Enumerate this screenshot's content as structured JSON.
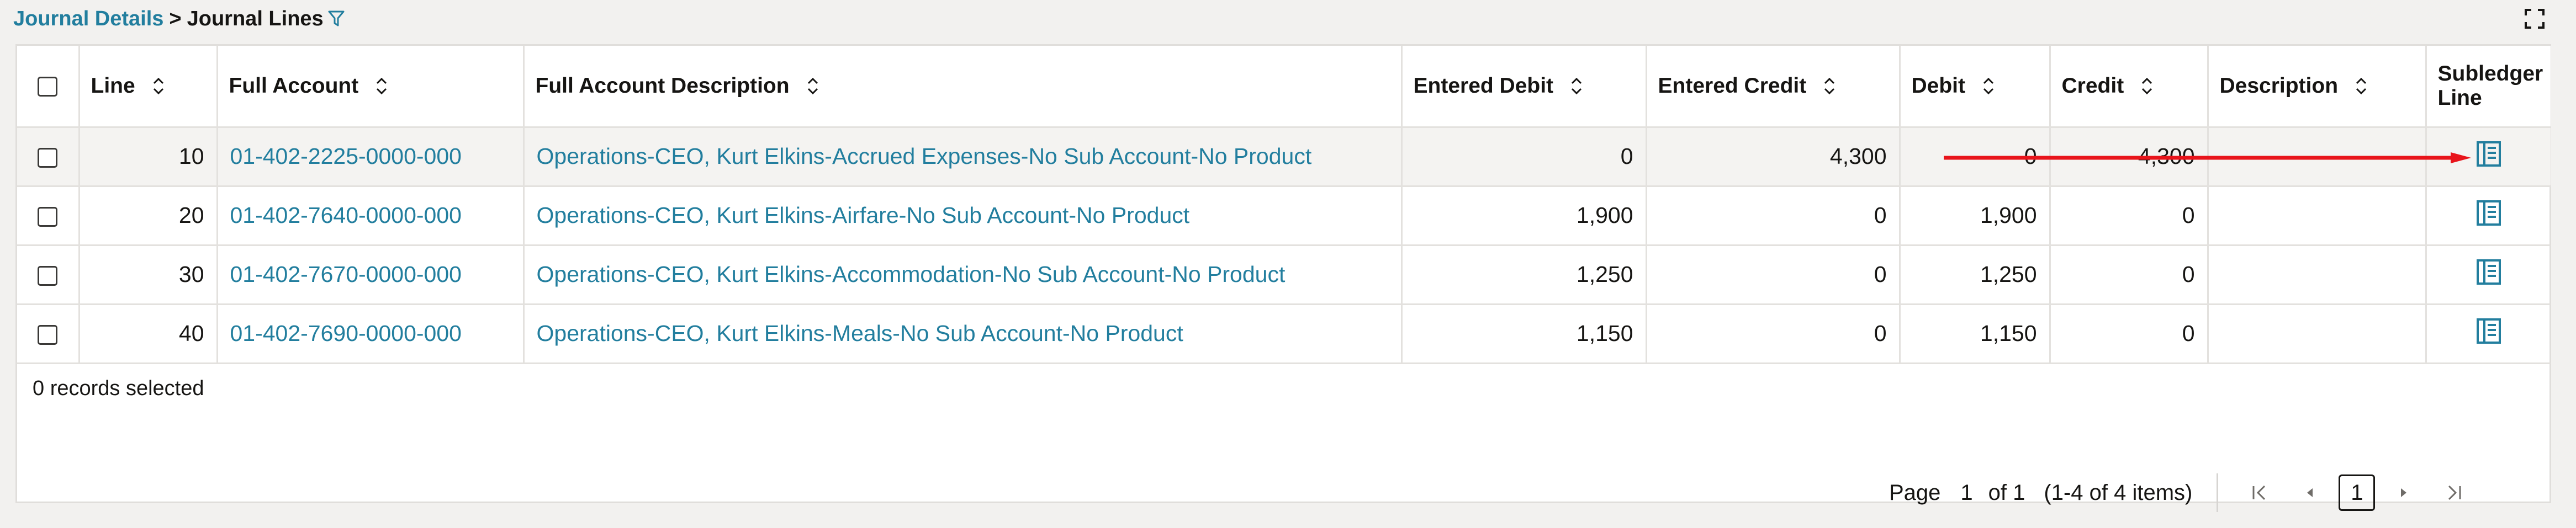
{
  "breadcrumb": {
    "parent": "Journal Details",
    "separator": ">",
    "current": "Journal Lines"
  },
  "icons": {
    "filter": "filter-icon",
    "expand": "expand-icon",
    "sort": "sort-icon",
    "subledger": "document-list-icon"
  },
  "colors": {
    "link": "#227e9e",
    "annotation_arrow": "#e8141b"
  },
  "table": {
    "columns": [
      "Line",
      "Full Account",
      "Full Account Description",
      "Entered Debit",
      "Entered Credit",
      "Debit",
      "Credit",
      "Description",
      "Subledger Line"
    ],
    "rows": [
      {
        "line": "10",
        "account": "01-402-2225-0000-000",
        "account_desc": "Operations-CEO, Kurt Elkins-Accrued Expenses-No Sub Account-No Product",
        "entered_debit": "0",
        "entered_credit": "4,300",
        "debit": "0",
        "credit": "4,300",
        "description": ""
      },
      {
        "line": "20",
        "account": "01-402-7640-0000-000",
        "account_desc": "Operations-CEO, Kurt Elkins-Airfare-No Sub Account-No Product",
        "entered_debit": "1,900",
        "entered_credit": "0",
        "debit": "1,900",
        "credit": "0",
        "description": ""
      },
      {
        "line": "30",
        "account": "01-402-7670-0000-000",
        "account_desc": "Operations-CEO, Kurt Elkins-Accommodation-No Sub Account-No Product",
        "entered_debit": "1,250",
        "entered_credit": "0",
        "debit": "1,250",
        "credit": "0",
        "description": ""
      },
      {
        "line": "40",
        "account": "01-402-7690-0000-000",
        "account_desc": "Operations-CEO, Kurt Elkins-Meals-No Sub Account-No Product",
        "entered_debit": "1,150",
        "entered_credit": "0",
        "debit": "1,150",
        "credit": "0",
        "description": ""
      }
    ]
  },
  "status": {
    "selected": "0 records selected"
  },
  "pagination": {
    "page_label": "Page",
    "page_value": "1",
    "of_label": "of 1",
    "items_label": "(1-4 of 4 items)",
    "current_page": "1"
  }
}
